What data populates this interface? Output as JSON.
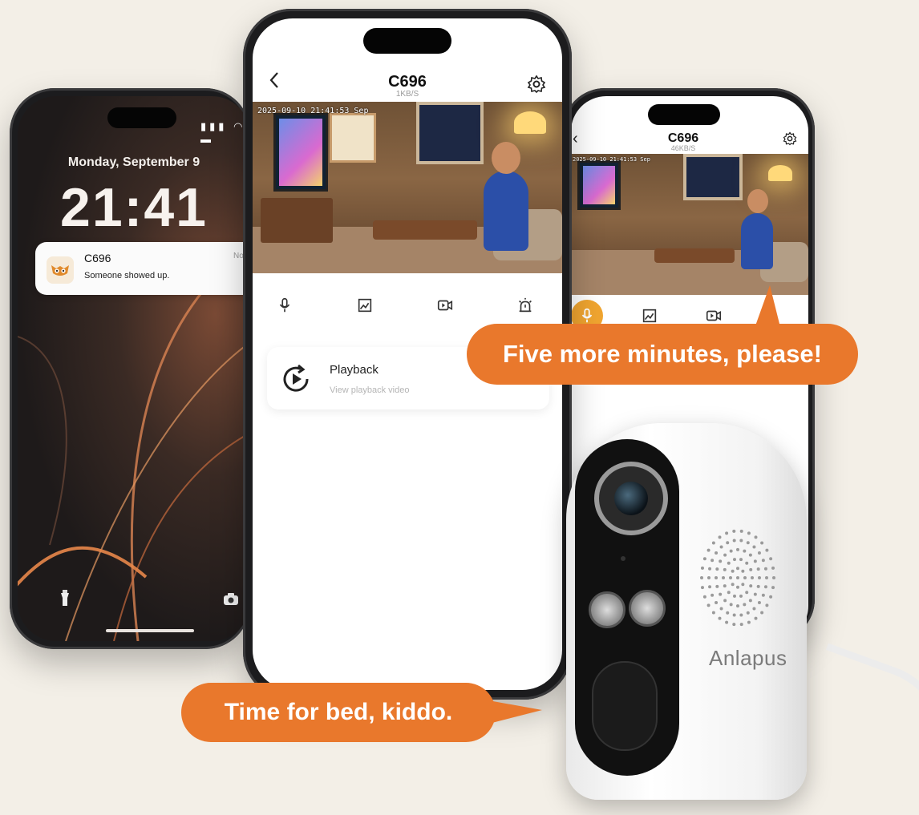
{
  "lock_screen": {
    "date": "Monday, September 9",
    "time": "21:41",
    "status_icons": "▮▮▮ ◠ ▬",
    "notification": {
      "app_icon": "owl-logo-icon",
      "title": "C696",
      "message": "Someone showed up.",
      "time": "Now"
    }
  },
  "app_main": {
    "camera_name": "C696",
    "data_rate": "1KB/S",
    "timestamp": "2025-09-10 21:41:53  Sep",
    "controls": [
      "microphone-icon",
      "snapshot-icon",
      "record-video-icon",
      "alarm-icon"
    ],
    "playback": {
      "icon": "playback-icon",
      "title": "Playback",
      "subtitle": "View playback video"
    }
  },
  "app_right": {
    "camera_name": "C696",
    "data_rate": "46KB/S",
    "timestamp": "2025-09-10 21:41:53  Sep"
  },
  "bubbles": {
    "kid": "Five more minutes, please!",
    "parent": "Time for bed, kiddo."
  },
  "camera_brand": "Anlapus",
  "colors": {
    "accent_orange": "#e9782c",
    "mic_active": "#f0a530"
  }
}
